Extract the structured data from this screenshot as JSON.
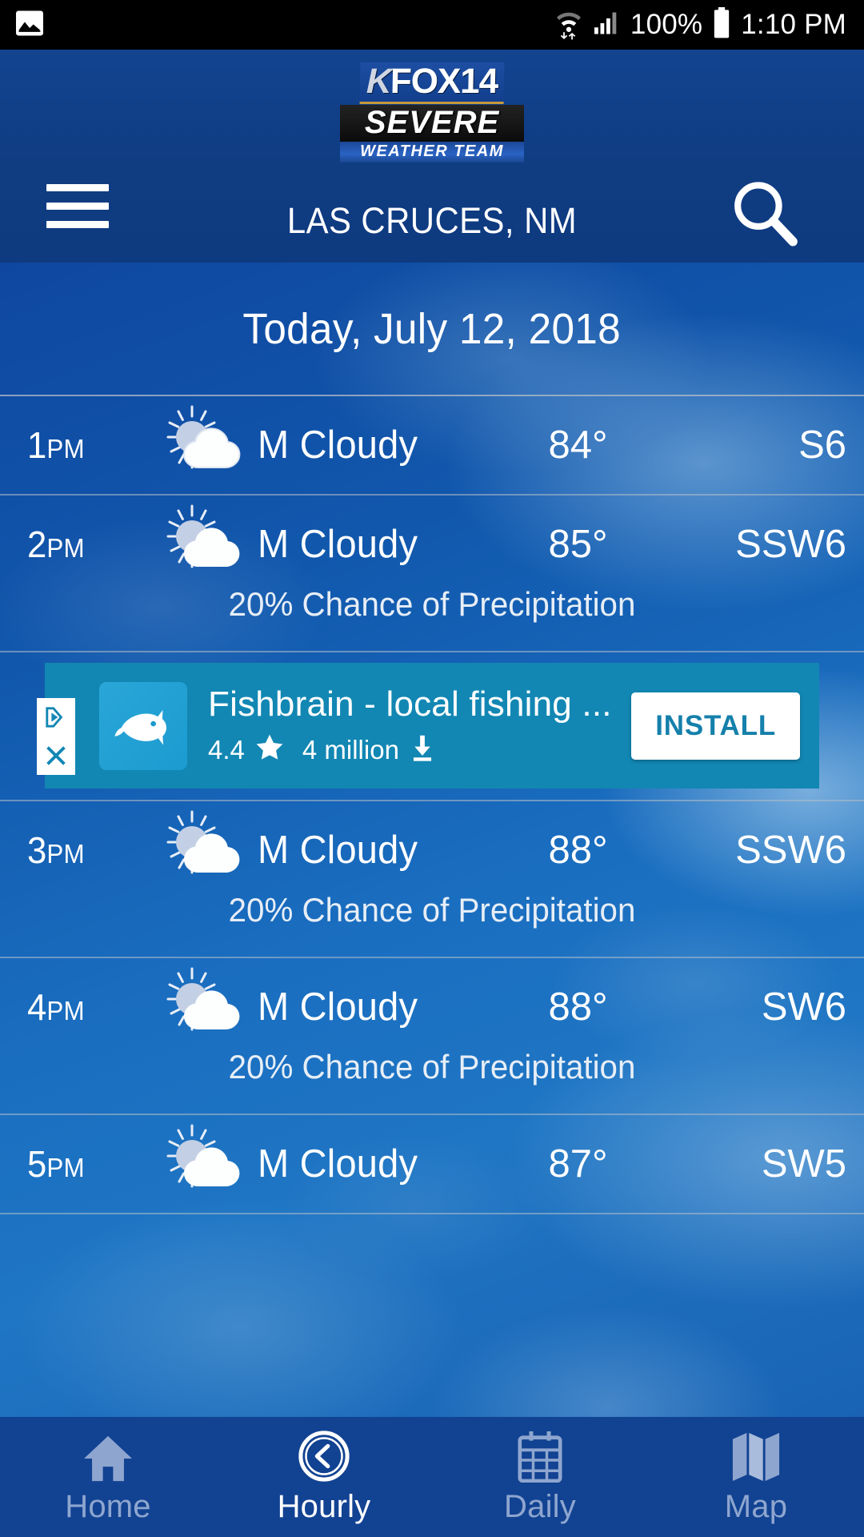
{
  "status_bar": {
    "time": "1:10 PM",
    "battery_percent": "100%",
    "icons": [
      "image-icon",
      "wifi-icon",
      "cellular-signal-icon",
      "battery-icon"
    ]
  },
  "header": {
    "menu_icon": "hamburger-menu-icon",
    "search_icon": "search-icon",
    "logo": {
      "k": "K",
      "fox14": "FOX14",
      "severe": "SEVERE",
      "weather_team": "WEATHER TEAM"
    },
    "location": "LAS CRUCES, NM",
    "background_color": "#123f88"
  },
  "main": {
    "date_title": "Today, July 12, 2018",
    "rows": [
      {
        "time": "1",
        "ampm": "PM",
        "icon": "sun-behind-cloud-icon",
        "condition": "M Cloudy",
        "temperature": "84°",
        "wind": "S6",
        "precipitation": ""
      },
      {
        "time": "2",
        "ampm": "PM",
        "icon": "sun-behind-cloud-icon",
        "condition": "M Cloudy",
        "temperature": "85°",
        "wind": "SSW6",
        "precipitation": "20% Chance of Precipitation"
      },
      {
        "time": "3",
        "ampm": "PM",
        "icon": "sun-behind-cloud-icon",
        "condition": "M Cloudy",
        "temperature": "88°",
        "wind": "SSW6",
        "precipitation": "20% Chance of Precipitation"
      },
      {
        "time": "4",
        "ampm": "PM",
        "icon": "sun-behind-cloud-icon",
        "condition": "M Cloudy",
        "temperature": "88°",
        "wind": "SW6",
        "precipitation": "20% Chance of Precipitation"
      },
      {
        "time": "5",
        "ampm": "PM",
        "icon": "sun-behind-cloud-icon",
        "condition": "M Cloudy",
        "temperature": "87°",
        "wind": "SW5",
        "precipitation": ""
      }
    ]
  },
  "advertisement": {
    "title": "Fishbrain - local fishing ...",
    "rating": "4.4",
    "downloads": "4 million",
    "install_label": "INSTALL",
    "app_icon": "fish-icon",
    "star_icon": "star-icon",
    "download_icon": "download-icon",
    "adchoices_icon": "adchoices-icon",
    "close_icon": "close-icon",
    "background_color": "#1287b3",
    "install_text_color": "#1580ab"
  },
  "bottom_nav": {
    "items": [
      {
        "label": "Home",
        "icon": "home-icon",
        "active": false
      },
      {
        "label": "Hourly",
        "icon": "clock-icon",
        "active": true
      },
      {
        "label": "Daily",
        "icon": "calendar-icon",
        "active": false
      },
      {
        "label": "Map",
        "icon": "map-icon",
        "active": false
      }
    ],
    "active_color": "#ffffff",
    "inactive_color": "#8ea6cf",
    "background_color": "#124292"
  }
}
